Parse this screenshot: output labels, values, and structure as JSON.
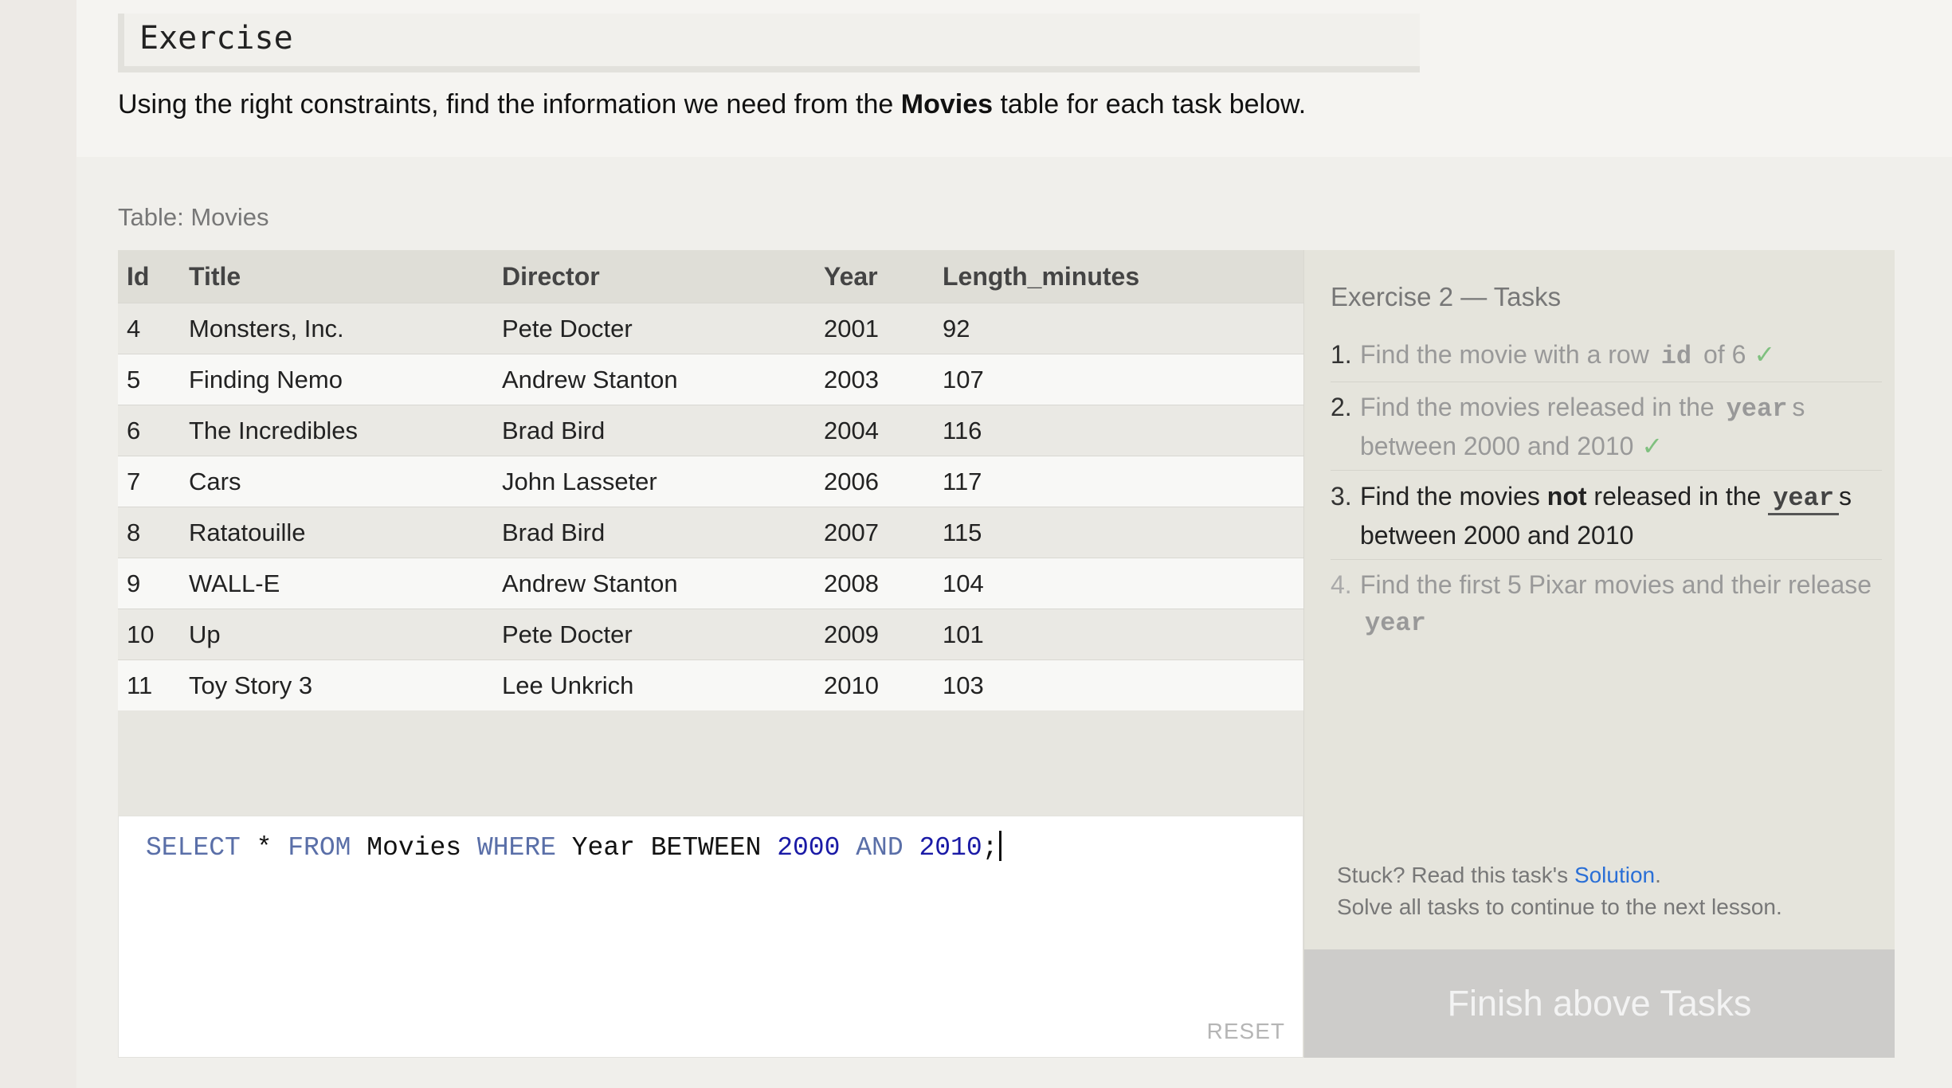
{
  "exercise": {
    "header": "Exercise",
    "intro_before": "Using the right constraints, find the information we need from the",
    "intro_bold": "Movies",
    "intro_after": "table for each task below."
  },
  "table": {
    "caption": "Table: Movies",
    "columns": [
      "Id",
      "Title",
      "Director",
      "Year",
      "Length_minutes"
    ],
    "rows": [
      [
        "4",
        "Monsters, Inc.",
        "Pete Docter",
        "2001",
        "92"
      ],
      [
        "5",
        "Finding Nemo",
        "Andrew Stanton",
        "2003",
        "107"
      ],
      [
        "6",
        "The Incredibles",
        "Brad Bird",
        "2004",
        "116"
      ],
      [
        "7",
        "Cars",
        "John Lasseter",
        "2006",
        "117"
      ],
      [
        "8",
        "Ratatouille",
        "Brad Bird",
        "2007",
        "115"
      ],
      [
        "9",
        "WALL-E",
        "Andrew Stanton",
        "2008",
        "104"
      ],
      [
        "10",
        "Up",
        "Pete Docter",
        "2009",
        "101"
      ],
      [
        "11",
        "Toy Story 3",
        "Lee Unkrich",
        "2010",
        "103"
      ]
    ]
  },
  "editor": {
    "query": {
      "k1": "SELECT",
      "star": " * ",
      "k2": "FROM",
      "tbl": " Movies ",
      "k3": "WHERE",
      "mid": " Year BETWEEN ",
      "n1": "2000",
      "k4": "AND",
      "n2": "2010",
      "end": ";"
    },
    "reset_label": "RESET"
  },
  "tasks": {
    "title": "Exercise 2 — Tasks",
    "items": [
      {
        "num": "1.",
        "before": "Find the movie with a row",
        "code": "id",
        "after": "of 6",
        "done": true,
        "check": "✓"
      },
      {
        "num": "2.",
        "before": "Find the movies released in the",
        "code": "year",
        "after": "s between 2000 and 2010",
        "done": true,
        "check": "✓"
      },
      {
        "num": "3.",
        "before": "Find the movies",
        "bold": "not",
        "mid": "released in the",
        "code": "year",
        "after": "s between 2000 and 2010",
        "done": false
      },
      {
        "num": "4.",
        "before": "Find the first 5 Pixar movies and their release",
        "code": "year",
        "done": false
      }
    ],
    "help_prefix": "Stuck? Read this task's",
    "help_link": "Solution",
    "help_suffix": ".",
    "help_line2": "Solve all tasks to continue to the next lesson.",
    "finish_label": "Finish above Tasks"
  },
  "colors": {
    "keyword": "#5a6fa8",
    "number": "#1a1aa6",
    "check": "#7fc07f",
    "link": "#2a6fd6"
  }
}
